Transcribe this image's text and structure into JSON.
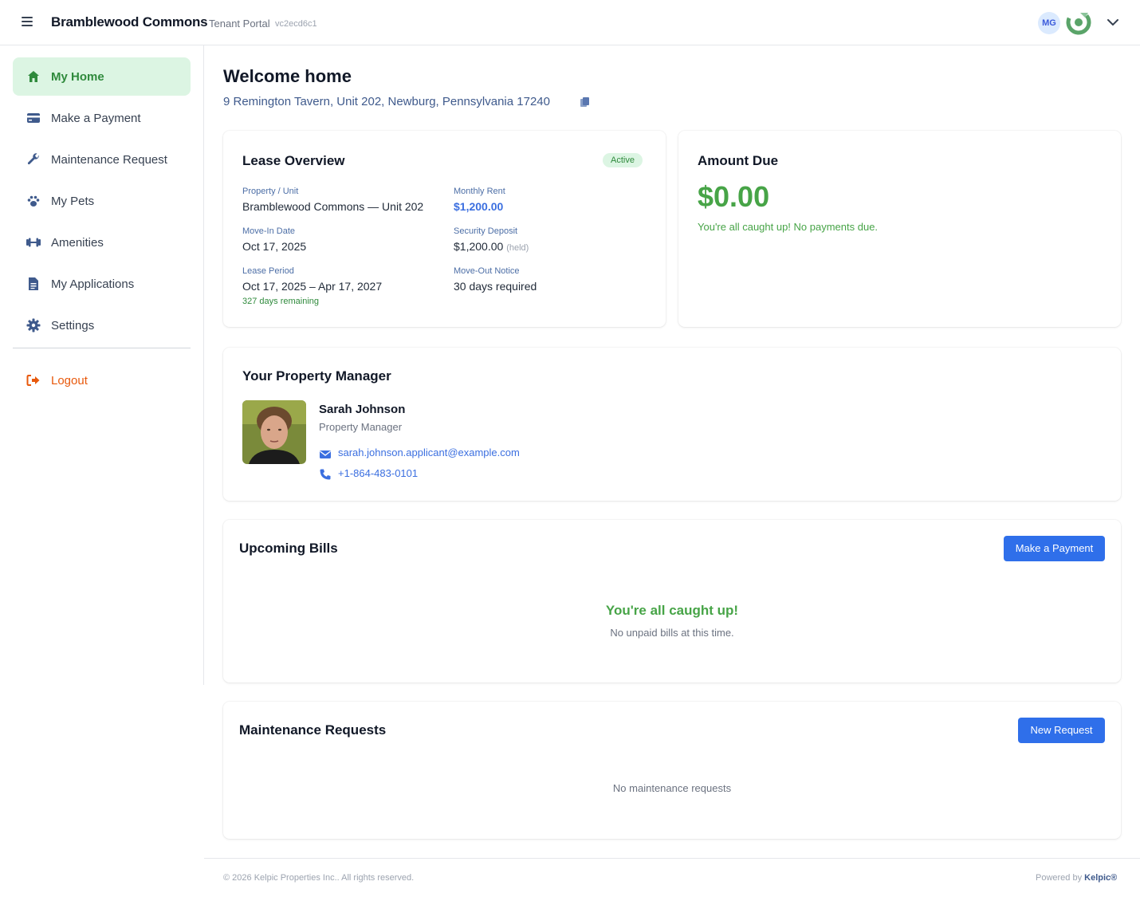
{
  "header": {
    "brand": "Bramblewood Commons",
    "subtitle": "Tenant Portal",
    "version": "vc2ecd6c1",
    "user_initials": "MG"
  },
  "sidebar": {
    "items": [
      {
        "label": "My Home",
        "icon": "home-icon",
        "active": true
      },
      {
        "label": "Make a Payment",
        "icon": "credit-card-icon"
      },
      {
        "label": "Maintenance Request",
        "icon": "wrench-icon"
      },
      {
        "label": "My Pets",
        "icon": "paw-icon"
      },
      {
        "label": "Amenities",
        "icon": "dumbbell-icon"
      },
      {
        "label": "My Applications",
        "icon": "document-icon"
      },
      {
        "label": "Settings",
        "icon": "gear-icon"
      }
    ],
    "logout": {
      "label": "Logout",
      "icon": "logout-icon"
    }
  },
  "main": {
    "title": "Welcome home",
    "address": "9 Remington Tavern, Unit 202, Newburg, Pennsylvania 17240"
  },
  "lease": {
    "title": "Lease Overview",
    "status": "Active",
    "property_label": "Property / Unit",
    "property_value": "Bramblewood Commons — Unit 202",
    "rent_label": "Monthly Rent",
    "rent_value": "$1,200.00",
    "movein_label": "Move-In Date",
    "movein_value": "Oct 17, 2025",
    "deposit_label": "Security Deposit",
    "deposit_value": "$1,200.00",
    "deposit_note": "(held)",
    "period_label": "Lease Period",
    "period_value": "Oct 17, 2025 – Apr 17, 2027",
    "days_remaining": "327 days remaining",
    "notice_label": "Move-Out Notice",
    "notice_value": "30 days required"
  },
  "amount_due": {
    "title": "Amount Due",
    "value": "$0.00",
    "note": "You're all caught up! No payments due."
  },
  "manager": {
    "title": "Your Property Manager",
    "name": "Sarah Johnson",
    "role": "Property Manager",
    "email": "sarah.johnson.applicant@example.com",
    "phone": "+1-864-483-0101"
  },
  "bills": {
    "title": "Upcoming Bills",
    "button": "Make a Payment",
    "empty_title": "You're all caught up!",
    "empty_sub": "No unpaid bills at this time."
  },
  "maintenance": {
    "title": "Maintenance Requests",
    "button": "New Request",
    "empty": "No maintenance requests"
  },
  "footer": {
    "copyright": "© 2026 Kelpic Properties Inc.. All rights reserved.",
    "powered_prefix": "Powered by",
    "powered_brand": "Kelpic®"
  },
  "colors": {
    "accent_green": "#47a447",
    "primary_blue": "#2f6fea",
    "logout_orange": "#e8590c"
  }
}
